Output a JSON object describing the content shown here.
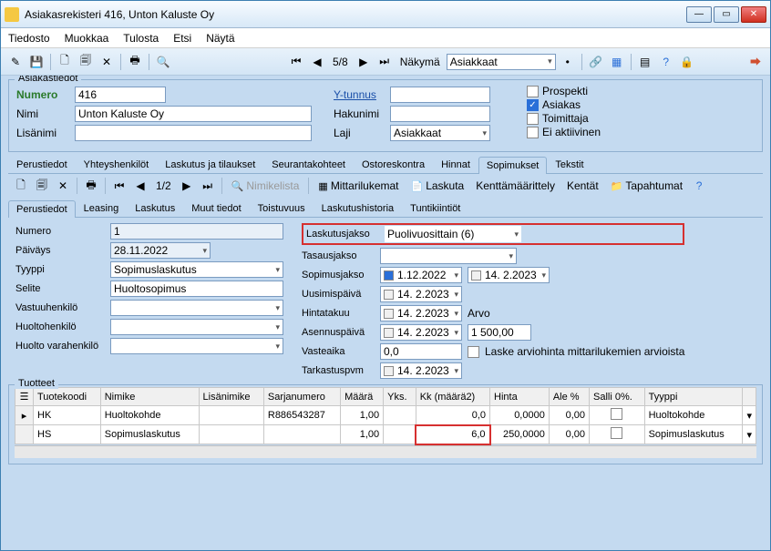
{
  "title": "Asiakasrekisteri 416, Unton Kaluste Oy",
  "menu": [
    "Tiedosto",
    "Muokkaa",
    "Tulosta",
    "Etsi",
    "Näytä"
  ],
  "toolbar": {
    "pager": "5/8",
    "view_label": "Näkymä",
    "view_value": "Asiakkaat"
  },
  "customer": {
    "legend": "Asiakastiedot",
    "numero_label": "Numero",
    "numero": "416",
    "nimi_label": "Nimi",
    "nimi": "Unton Kaluste Oy",
    "lisanimi_label": "Lisänimi",
    "lisanimi": "",
    "ytunnus_label": "Y-tunnus",
    "ytunnus": "",
    "hakunimi_label": "Hakunimi",
    "hakunimi": "",
    "laji_label": "Laji",
    "laji": "Asiakkaat",
    "flags": {
      "prospekti": "Prospekti",
      "asiakas": "Asiakas",
      "toimittaja": "Toimittaja",
      "ei_aktiivinen": "Ei aktiivinen"
    }
  },
  "main_tabs": [
    "Perustiedot",
    "Yhteyshenkilöt",
    "Laskutus ja tilaukset",
    "Seurantakohteet",
    "Ostoreskontra",
    "Hinnat",
    "Sopimukset",
    "Tekstit"
  ],
  "main_tab_active": 6,
  "sub_toolbar": {
    "pager": "1/2",
    "nimikelista": "Nimikelista",
    "mittarilukemat": "Mittarilukemat",
    "laskuta": "Laskuta",
    "kenttamaarittely": "Kenttämäärittely",
    "kentat": "Kentät",
    "tapahtumat": "Tapahtumat"
  },
  "sub_tabs": [
    "Perustiedot",
    "Leasing",
    "Laskutus",
    "Muut tiedot",
    "Toistuvuus",
    "Laskutushistoria",
    "Tuntikiintiöt"
  ],
  "sub_tab_active": 0,
  "contract": {
    "numero_l": "Numero",
    "numero": "1",
    "paivays_l": "Päiväys",
    "paivays": "28.11.2022",
    "tyyppi_l": "Tyyppi",
    "tyyppi": "Sopimuslaskutus",
    "selite_l": "Selite",
    "selite": "Huoltosopimus",
    "vastuuhenkilo_l": "Vastuuhenkilö",
    "huoltohenkilo_l": "Huoltohenkilö",
    "huolto_varahenkilo_l": "Huolto varahenkilö",
    "laskutusjakso_l": "Laskutusjakso",
    "laskutusjakso": "Puolivuosittain (6)",
    "tasausjakso_l": "Tasausjakso",
    "tasausjakso": "",
    "sopimusjakso_l": "Sopimusjakso",
    "sopimusjakso_a": "1.12.2022",
    "sopimusjakso_b": "14. 2.2023",
    "uusimispaiva_l": "Uusimispäivä",
    "uusimispaiva": "14. 2.2023",
    "hintatakuu_l": "Hintatakuu",
    "hintatakuu": "14. 2.2023",
    "asennuspaiva_l": "Asennuspäivä",
    "asennuspaiva": "14. 2.2023",
    "vasteaika_l": "Vasteaika",
    "vasteaika": "0,0",
    "tarkastuspvm_l": "Tarkastuspvm",
    "tarkastuspvm": "14. 2.2023",
    "arvo_l": "Arvo",
    "arvo": "1 500,00",
    "laske_l": "Laske arviohinta mittarilukemien arvioista"
  },
  "grid": {
    "legend": "Tuotteet",
    "headers": [
      "Tuotekoodi",
      "Nimike",
      "Lisänimike",
      "Sarjanumero",
      "Määrä",
      "Yks.",
      "Kk (määrä2)",
      "Hinta",
      "Ale %",
      "Salli 0%.",
      "Tyyppi"
    ],
    "rows": [
      {
        "code": "HK",
        "name": "Huoltokohde",
        "extra": "",
        "serial": "R886543287",
        "qty": "1,00",
        "unit": "",
        "kk": "0,0",
        "price": "0,0000",
        "ale": "0,00",
        "allow": false,
        "type": "Huoltokohde"
      },
      {
        "code": "HS",
        "name": "Sopimuslaskutus",
        "extra": "",
        "serial": "",
        "qty": "1,00",
        "unit": "",
        "kk": "6,0",
        "price": "250,0000",
        "ale": "0,00",
        "allow": false,
        "type": "Sopimuslaskutus"
      }
    ]
  }
}
